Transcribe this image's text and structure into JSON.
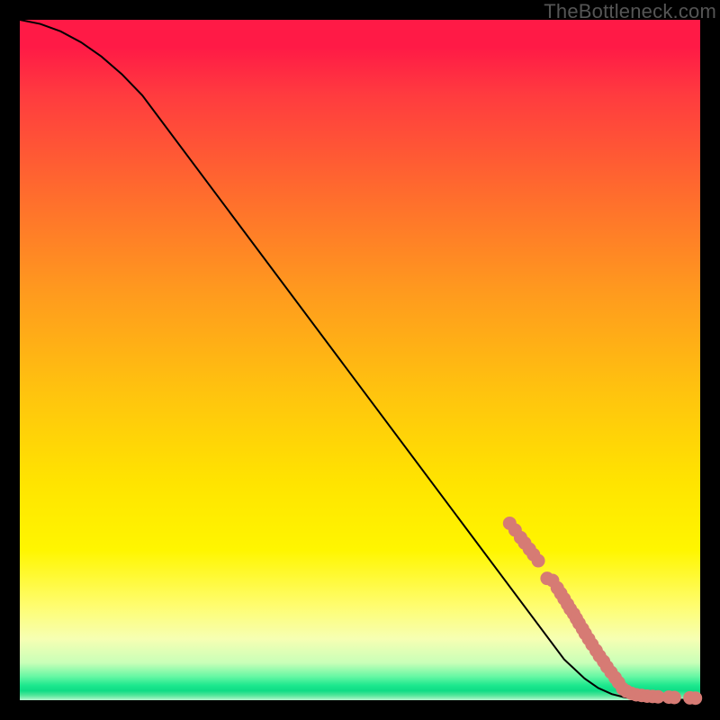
{
  "watermark": "TheBottleneck.com",
  "colors": {
    "dot": "#d67b74",
    "curve": "#000000"
  },
  "chart_data": {
    "type": "line",
    "title": "",
    "xlabel": "",
    "ylabel": "",
    "xlim": [
      0,
      100
    ],
    "ylim": [
      0,
      100
    ],
    "grid": false,
    "curve": [
      {
        "x": 0,
        "y": 100.0
      },
      {
        "x": 3,
        "y": 99.4
      },
      {
        "x": 6,
        "y": 98.3
      },
      {
        "x": 9,
        "y": 96.7
      },
      {
        "x": 12,
        "y": 94.6
      },
      {
        "x": 15,
        "y": 92.0
      },
      {
        "x": 18,
        "y": 88.9
      },
      {
        "x": 80,
        "y": 6.0
      },
      {
        "x": 83,
        "y": 3.2
      },
      {
        "x": 85,
        "y": 1.8
      },
      {
        "x": 87,
        "y": 0.9
      },
      {
        "x": 89,
        "y": 0.4
      },
      {
        "x": 92,
        "y": 0.15
      },
      {
        "x": 96,
        "y": 0.08
      },
      {
        "x": 100,
        "y": 0.05
      }
    ],
    "scatter": [
      {
        "x": 72.0,
        "y": 26.0
      },
      {
        "x": 72.8,
        "y": 25.0
      },
      {
        "x": 73.6,
        "y": 23.9
      },
      {
        "x": 74.2,
        "y": 23.1
      },
      {
        "x": 74.9,
        "y": 22.2
      },
      {
        "x": 75.5,
        "y": 21.4
      },
      {
        "x": 76.2,
        "y": 20.5
      },
      {
        "x": 77.5,
        "y": 17.9
      },
      {
        "x": 78.3,
        "y": 17.6
      },
      {
        "x": 79.0,
        "y": 16.5
      },
      {
        "x": 79.5,
        "y": 15.7
      },
      {
        "x": 80.0,
        "y": 14.9
      },
      {
        "x": 80.5,
        "y": 14.1
      },
      {
        "x": 80.9,
        "y": 13.4
      },
      {
        "x": 81.4,
        "y": 12.7
      },
      {
        "x": 81.8,
        "y": 12.0
      },
      {
        "x": 82.2,
        "y": 11.3
      },
      {
        "x": 82.7,
        "y": 10.5
      },
      {
        "x": 83.1,
        "y": 9.8
      },
      {
        "x": 83.6,
        "y": 9.0
      },
      {
        "x": 84.1,
        "y": 8.2
      },
      {
        "x": 84.7,
        "y": 7.3
      },
      {
        "x": 85.2,
        "y": 6.5
      },
      {
        "x": 85.8,
        "y": 5.7
      },
      {
        "x": 86.3,
        "y": 4.9
      },
      {
        "x": 86.9,
        "y": 4.1
      },
      {
        "x": 87.5,
        "y": 3.3
      },
      {
        "x": 88.0,
        "y": 2.6
      },
      {
        "x": 88.6,
        "y": 1.7
      },
      {
        "x": 89.2,
        "y": 1.3
      },
      {
        "x": 89.9,
        "y": 1.0
      },
      {
        "x": 90.6,
        "y": 0.8
      },
      {
        "x": 91.4,
        "y": 0.7
      },
      {
        "x": 92.2,
        "y": 0.6
      },
      {
        "x": 93.0,
        "y": 0.55
      },
      {
        "x": 93.8,
        "y": 0.5
      },
      {
        "x": 95.4,
        "y": 0.45
      },
      {
        "x": 96.2,
        "y": 0.4
      },
      {
        "x": 98.5,
        "y": 0.35
      },
      {
        "x": 99.3,
        "y": 0.3
      }
    ],
    "dot_radius_px": 7
  }
}
